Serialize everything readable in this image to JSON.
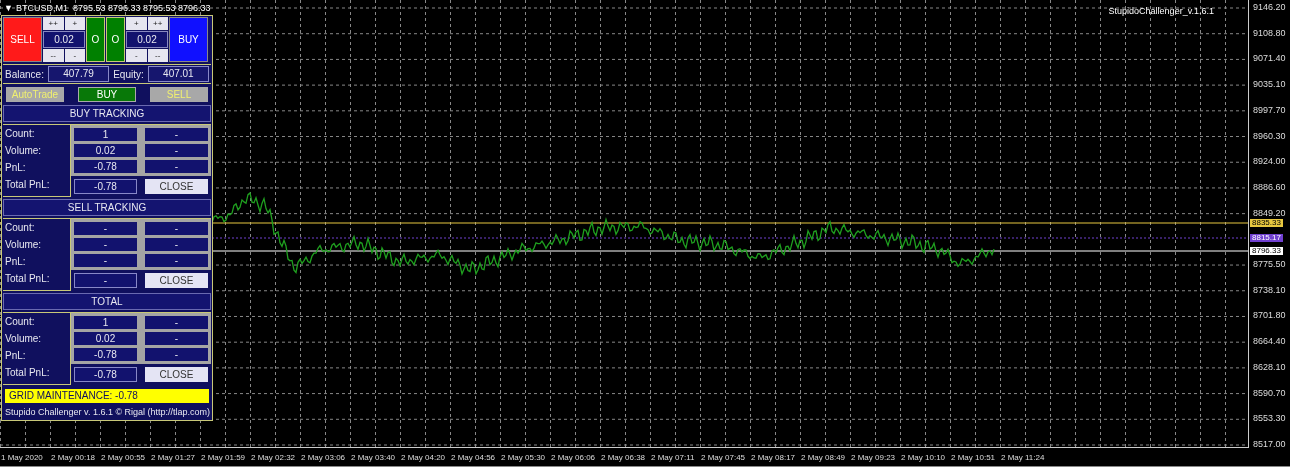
{
  "chart_header": {
    "caret": "▼",
    "title": "BTCUSD,M1  8795.53 8796.33 8795.53 8796.33"
  },
  "indicator_label": "StupidoChallenger_v.1.6.1",
  "panel": {
    "trade_row": {
      "sell": "SELL",
      "buy": "BUY",
      "left_lot": {
        "plus": [
          "++",
          "+"
        ],
        "value": "0.02",
        "minus": [
          "--",
          "-"
        ]
      },
      "zero_buttons": [
        "O",
        "O"
      ],
      "right_lot": {
        "plus": [
          "+",
          "++"
        ],
        "value": "0.02",
        "minus": [
          "-",
          "--"
        ]
      }
    },
    "account": [
      {
        "label": "Balance:",
        "value": "407.79"
      },
      {
        "label": "Equity:",
        "value": "407.01"
      }
    ],
    "mode_buttons": [
      {
        "label": "AutoTrade",
        "on": false
      },
      {
        "label": "BUY",
        "on": true
      },
      {
        "label": "SELL",
        "on": false
      }
    ],
    "sections": [
      {
        "title": "BUY TRACKING",
        "rows": [
          {
            "label": "Count:",
            "values": [
              "1",
              "-"
            ]
          },
          {
            "label": "Volume:",
            "values": [
              "0.02",
              "-"
            ]
          },
          {
            "label": "PnL:",
            "values": [
              "-0.78",
              "-"
            ]
          }
        ],
        "total": {
          "label": "Total PnL:",
          "value": "-0.78",
          "button": "CLOSE"
        }
      },
      {
        "title": "SELL TRACKING",
        "rows": [
          {
            "label": "Count:",
            "values": [
              "-",
              "-"
            ]
          },
          {
            "label": "Volume:",
            "values": [
              "-",
              "-"
            ]
          },
          {
            "label": "PnL:",
            "values": [
              "-",
              "-"
            ]
          }
        ],
        "total": {
          "label": "Total PnL:",
          "value": "-",
          "button": "CLOSE"
        }
      },
      {
        "title": "TOTAL",
        "rows": [
          {
            "label": "Count:",
            "values": [
              "1",
              "-"
            ]
          },
          {
            "label": "Volume:",
            "values": [
              "0.02",
              "-"
            ]
          },
          {
            "label": "PnL:",
            "values": [
              "-0.78",
              "-"
            ]
          }
        ],
        "total": {
          "label": "Total PnL:",
          "value": "-0.78",
          "button": "CLOSE"
        }
      }
    ],
    "grid_maintenance": "GRID MAINTENANCE: -0.78",
    "footer": "Stupido Challenger v. 1.6.1 © Rigal (http://tlap.com)"
  },
  "price_lines": [
    {
      "label": "8835.33",
      "color": "#e8c840"
    },
    {
      "label": "8815.17",
      "color": "#7040d0"
    },
    {
      "label": "8796.33",
      "color": "#ffffff"
    }
  ],
  "price_axis": [
    "9146.20",
    "9108.80",
    "9071.40",
    "9035.10",
    "8997.70",
    "8960.30",
    "8924.00",
    "8886.60",
    "8849.20",
    "8775.50",
    "8738.10",
    "8701.80",
    "8664.40",
    "8628.10",
    "8590.70",
    "8553.30",
    "8517.00"
  ],
  "time_axis": [
    "1 May 2020",
    "2 May 00:18",
    "2 May 00:55",
    "2 May 01:27",
    "2 May 01:59",
    "2 May 02:32",
    "2 May 03:06",
    "2 May 03:40",
    "2 May 04:20",
    "2 May 04:56",
    "2 May 05:30",
    "2 May 06:06",
    "2 May 06:38",
    "2 May 07:11",
    "2 May 07:45",
    "2 May 08:17",
    "2 May 08:49",
    "2 May 09:23",
    "2 May 10:10",
    "2 May 10:51",
    "2 May 11:24"
  ]
}
